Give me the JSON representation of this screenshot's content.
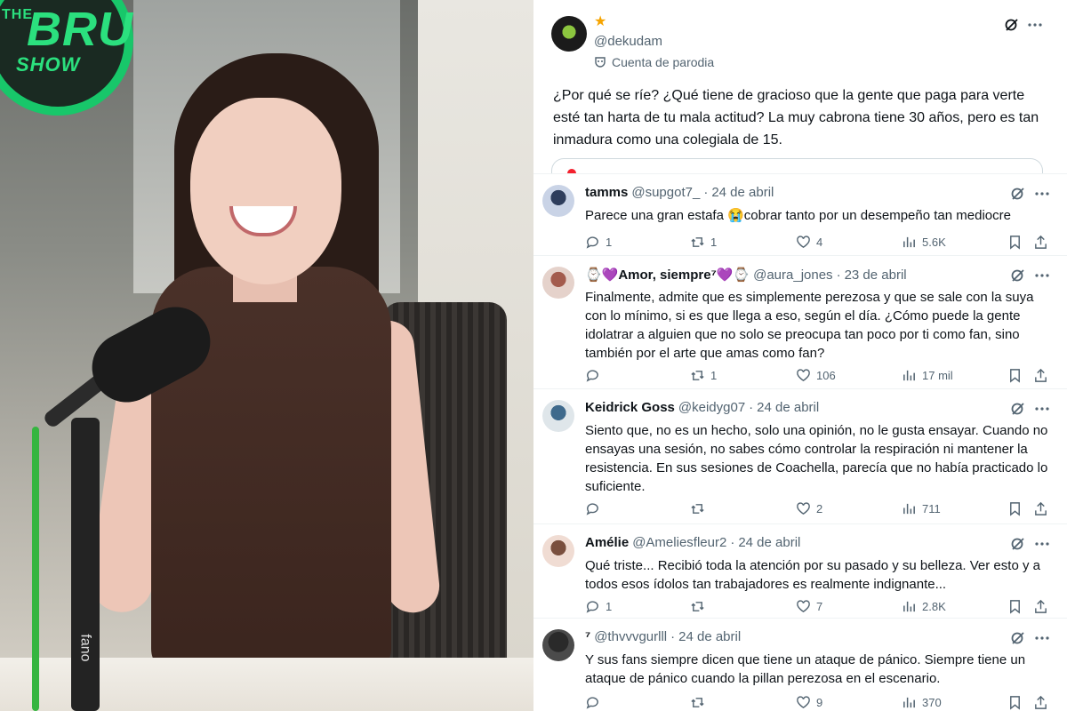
{
  "photo": {
    "logo_the": "THE",
    "logo_bru": "BRU",
    "logo_show": "SHOW",
    "stand_label": "fano"
  },
  "main_post": {
    "badge_icon": "star-icon",
    "handle": "@dekudam",
    "parody_label": "Cuenta de parodia",
    "text": "¿Por qué se ríe? ¿Qué tiene de gracioso que la gente que paga para verte esté tan harta de tu mala actitud? La muy cabrona tiene 30 años, pero es tan inmadura como una colegiala de 15."
  },
  "replies": [
    {
      "name": "tamms",
      "handle": "@supgot7_",
      "date": "24 de abril",
      "text": "Parece una gran estafa 😭cobrar tanto por un desempeño tan mediocre",
      "replies": "1",
      "reposts": "1",
      "likes": "4",
      "views": "5.6K"
    },
    {
      "name": "⌚💜Amor, siempre⁷💜⌚",
      "handle": "@aura_jones",
      "date": "23 de abril",
      "text": "Finalmente, admite que es simplemente perezosa y que se sale con la suya con lo mínimo, si es que llega a eso, según el día. ¿Cómo puede la gente idolatrar a alguien que no solo se preocupa tan poco por ti como fan, sino también por el arte que amas como fan?",
      "replies": "",
      "reposts": "1",
      "likes": "106",
      "views": "17 mil"
    },
    {
      "name": "Keidrick Goss",
      "handle": "@keidyg07",
      "date": "24 de abril",
      "text": "Siento que, no es un hecho, solo una opinión, no le gusta ensayar. Cuando no ensayas una sesión, no sabes cómo controlar la respiración ni mantener la resistencia. En sus sesiones de Coachella, parecía que no había practicado lo suficiente.",
      "replies": "",
      "reposts": "",
      "likes": "2",
      "views": "711"
    },
    {
      "name": "Amélie",
      "handle": "@Ameliesfleur2",
      "date": "24 de abril",
      "text": "Qué triste... Recibió toda la atención por su pasado y su belleza. Ver esto y a todos esos ídolos tan trabajadores es realmente indignante...",
      "replies": "1",
      "reposts": "",
      "likes": "7",
      "views": "2.8K"
    },
    {
      "name": "⁷",
      "handle": "@thvvvgurlll",
      "date": "24 de abril",
      "text": "Y sus fans siempre dicen que tiene un ataque de pánico. Siempre tiene un ataque de pánico cuando la pillan perezosa en el escenario.",
      "replies": "",
      "reposts": "",
      "likes": "9",
      "views": "370"
    }
  ],
  "colors": {
    "text": "#0f1419",
    "secondary": "#536471",
    "border": "#eff3f4",
    "badge": "#f6a400"
  }
}
